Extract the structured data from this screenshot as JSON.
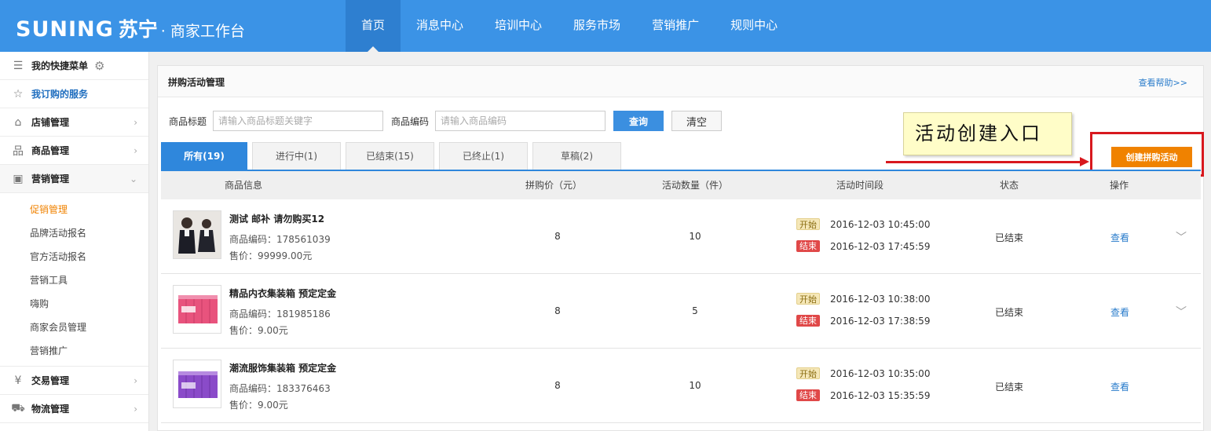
{
  "header": {
    "brand": "SUNING",
    "brand_cn": "苏宁",
    "subtitle": "· 商家工作台",
    "nav": [
      {
        "label": "首页",
        "active": true
      },
      {
        "label": "消息中心"
      },
      {
        "label": "培训中心"
      },
      {
        "label": "服务市场"
      },
      {
        "label": "营销推广"
      },
      {
        "label": "规则中心"
      }
    ]
  },
  "sidebar": {
    "quick_menu": "我的快捷菜单",
    "subscribed": "我订购的服务",
    "shop_mgmt": "店铺管理",
    "product_mgmt": "商品管理",
    "marketing_mgmt": "营销管理",
    "marketing_sub": [
      "促销管理",
      "品牌活动报名",
      "官方活动报名",
      "营销工具",
      "嗨购",
      "商家会员管理",
      "营销推广"
    ],
    "trade_mgmt": "交易管理",
    "logistics_mgmt": "物流管理"
  },
  "panel": {
    "title": "拼购活动管理",
    "help": "查看帮助>>",
    "search": {
      "title_label": "商品标题",
      "title_placeholder": "请输入商品标题关键字",
      "code_label": "商品编码",
      "code_placeholder": "请输入商品编码",
      "query": "查询",
      "clear": "清空"
    },
    "tabs": [
      "所有(19)",
      "进行中(1)",
      "已结束(15)",
      "已终止(1)",
      "草稿(2)"
    ],
    "annotation": "活动创建入口",
    "create_button": "创建拼购活动",
    "columns": [
      "商品信息",
      "拼购价（元）",
      "活动数量（件）",
      "活动时间段",
      "状态",
      "操作"
    ],
    "rows": [
      {
        "name": "测试 邮补 请勿购买12",
        "code": "商品编码：178561039",
        "price": "售价：99999.00元",
        "group_price": "8",
        "quantity": "10",
        "start_tag": "开始",
        "start_time": "2016-12-03 10:45:00",
        "end_tag": "结束",
        "end_time": "2016-12-03 17:45:59",
        "status": "已结束",
        "action": "查看"
      },
      {
        "name": "精品内衣集装箱 预定定金",
        "code": "商品编码：181985186",
        "price": "售价：9.00元",
        "group_price": "8",
        "quantity": "5",
        "start_tag": "开始",
        "start_time": "2016-12-03 10:38:00",
        "end_tag": "结束",
        "end_time": "2016-12-03 17:38:59",
        "status": "已结束",
        "action": "查看"
      },
      {
        "name": "潮流服饰集装箱 预定定金",
        "code": "商品编码：183376463",
        "price": "售价：9.00元",
        "group_price": "8",
        "quantity": "10",
        "start_tag": "开始",
        "start_time": "2016-12-03 10:35:00",
        "end_tag": "结束",
        "end_time": "2016-12-03 15:35:59",
        "status": "已结束",
        "action": "查看"
      }
    ]
  },
  "colors": {
    "header_blue": "#3b93e6",
    "tab_blue": "#2f87dc",
    "orange": "#f08200",
    "red": "#d8181e"
  }
}
